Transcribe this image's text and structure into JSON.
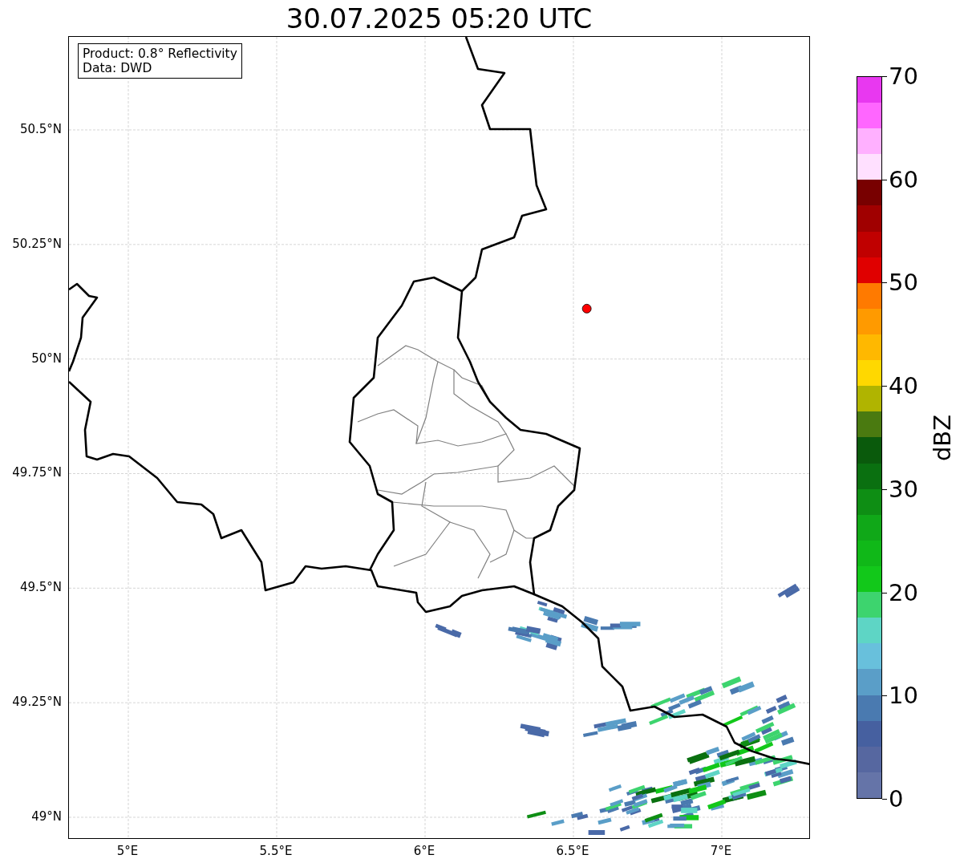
{
  "title": "30.07.2025 05:20 UTC",
  "info_box": {
    "lines": [
      "Product: 0.8° Reflectivity",
      "Data: DWD"
    ]
  },
  "map": {
    "lat_ticks": [
      "50.5°N",
      "50.25°N",
      "50°N",
      "49.75°N",
      "49.5°N",
      "49.25°N",
      "49°N"
    ],
    "lon_ticks": [
      "5°E",
      "5.5°E",
      "6°E",
      "6.5°E",
      "7°E"
    ],
    "marker": {
      "color": "#ff0000"
    }
  },
  "colorbar": {
    "label": "dBZ",
    "ticks": [
      "70",
      "60",
      "50",
      "40",
      "30",
      "20",
      "10",
      "0"
    ],
    "bands": [
      {
        "color": "#6574a8"
      },
      {
        "color": "#5667a0"
      },
      {
        "color": "#4660a0"
      },
      {
        "color": "#4a7ab0"
      },
      {
        "color": "#5a9ec8"
      },
      {
        "color": "#68c0dc"
      },
      {
        "color": "#5ed5c5"
      },
      {
        "color": "#3dd46e"
      },
      {
        "color": "#12c81a"
      },
      {
        "color": "#10b818"
      },
      {
        "color": "#10a818"
      },
      {
        "color": "#0e8e14"
      },
      {
        "color": "#0a7010"
      },
      {
        "color": "#0a5a0c"
      },
      {
        "color": "#4a7a10"
      },
      {
        "color": "#b0b400"
      },
      {
        "color": "#ffd800"
      },
      {
        "color": "#ffb800"
      },
      {
        "color": "#ff9a00"
      },
      {
        "color": "#ff7a00"
      },
      {
        "color": "#e00000"
      },
      {
        "color": "#c00000"
      },
      {
        "color": "#a00000"
      },
      {
        "color": "#780000"
      },
      {
        "color": "#ffe0ff"
      },
      {
        "color": "#ffb0ff"
      },
      {
        "color": "#ff66ff"
      },
      {
        "color": "#e838f0"
      }
    ]
  }
}
